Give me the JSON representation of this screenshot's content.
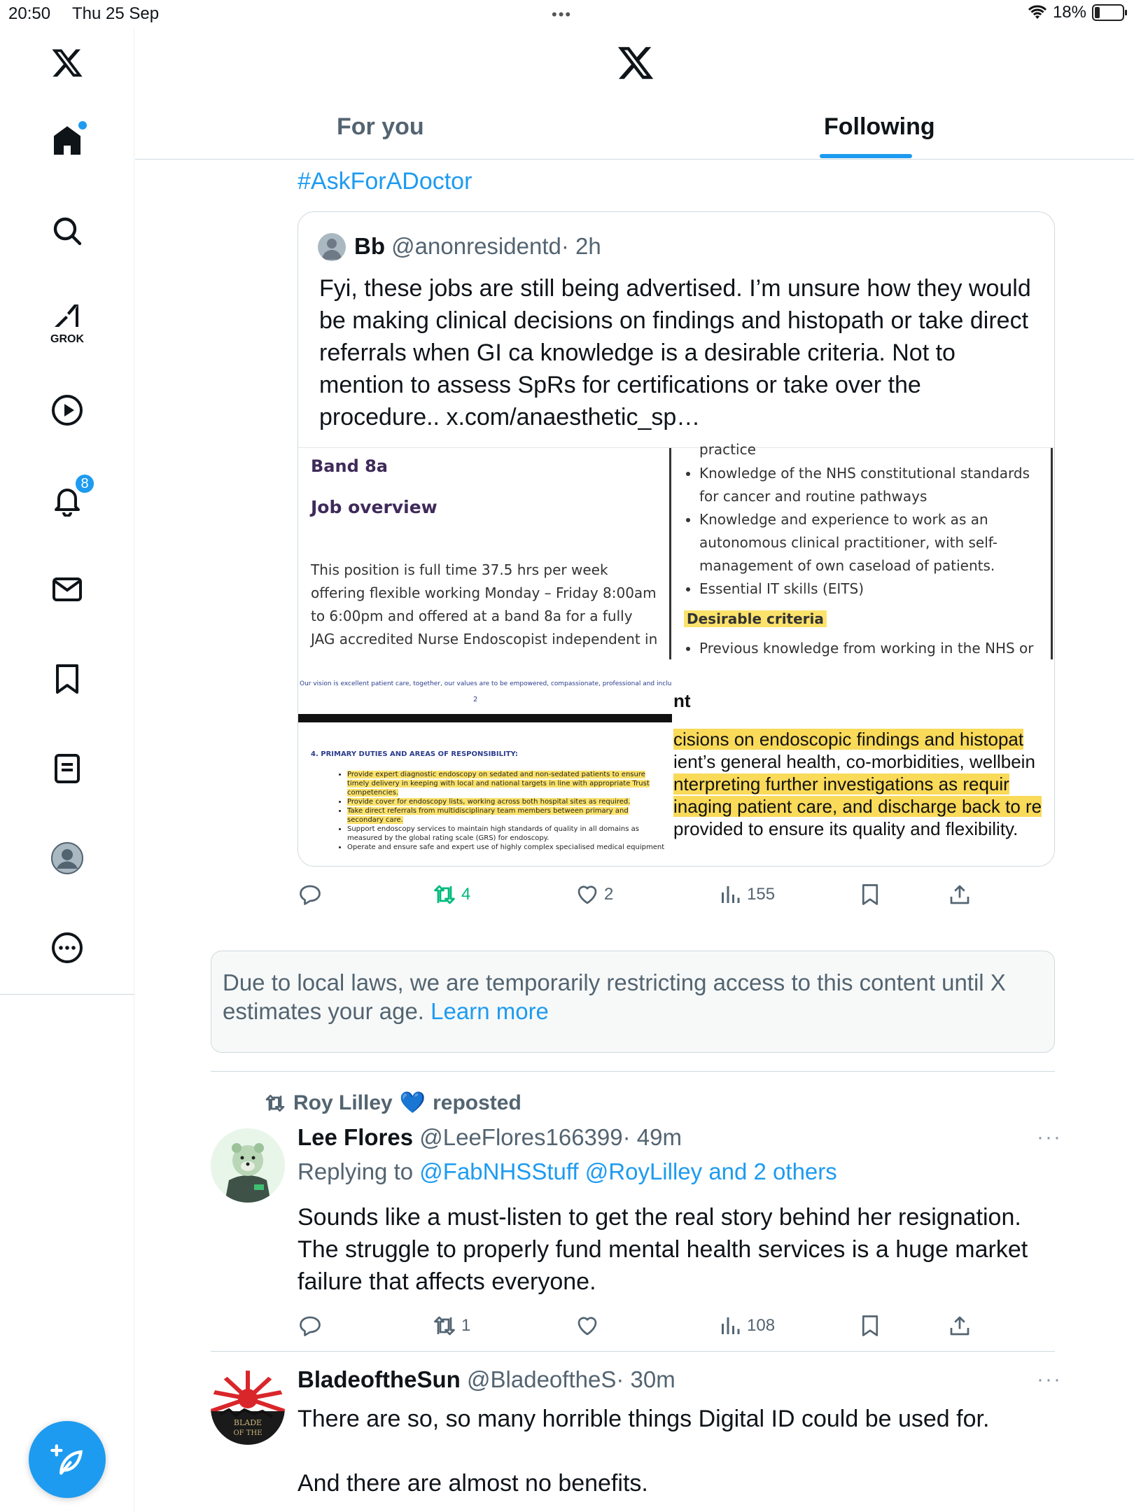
{
  "status_bar": {
    "time": "20:50",
    "date": "Thu 25 Sep",
    "battery": "18%",
    "battery_level_percent": 18
  },
  "sidebar": {
    "items": [
      {
        "icon": "x-logo-icon"
      },
      {
        "icon": "home-icon",
        "has_dot": true
      },
      {
        "icon": "search-icon"
      },
      {
        "icon": "grok-icon",
        "label": "GROK"
      },
      {
        "icon": "play-icon"
      },
      {
        "icon": "bell-icon",
        "badge": "8"
      },
      {
        "icon": "mail-icon"
      },
      {
        "icon": "bookmark-icon"
      },
      {
        "icon": "list-icon"
      },
      {
        "icon": "profile-avatar-icon"
      },
      {
        "icon": "more-circle-icon"
      }
    ],
    "compose_icon": "compose-post-icon",
    "accent": "#1d9bf0"
  },
  "header": {
    "logo": "x-logo-icon",
    "tabs": [
      {
        "label": "For you",
        "active": false
      },
      {
        "label": "Following",
        "active": true
      }
    ]
  },
  "feed": {
    "post1": {
      "hashtag": "#AskForADoctor",
      "quote": {
        "name": "Bb",
        "handle": "@anonresidentd",
        "time": "· 2h",
        "text": "Fyi, these jobs are still being advertised. I’m unsure how they would be making clinical decisions on findings and histopath or take direct referrals when GI ca knowledge is a desirable criteria.  Not to mention to assess SpRs for certifications or take over the procedure.. x.com/anaesthetic_sp…",
        "images": {
          "doc1": {
            "band": "Band 8a",
            "heading": "Job overview",
            "body": "This position is full time 37.5 hrs per week offering flexible working Monday – Friday 8:00am to 6:00pm and offered at a band 8a for a fully JAG accredited Nurse Endoscopist independent in"
          },
          "doc2": {
            "top": "practice",
            "bullets": [
              "Knowledge of the NHS constitutional standards for cancer and routine pathways",
              "Knowledge and experience to work as an autonomous clinical practitioner, with self-management of own caseload of patients.",
              "Essential IT skills (EITS)"
            ],
            "desirable": "Desirable criteria",
            "desirable_item": "Previous knowledge from working in the NHS or"
          },
          "doc3": {
            "vision": "Our vision is excellent patient care, together, our values are to be empowered, compassionate, professional and inclusive.",
            "page": "2",
            "heading": "4.   PRIMARY DUTIES AND AREAS OF RESPONSIBILITY:",
            "bullets": [
              "Provide expert diagnostic endoscopy on sedated and non-sedated patients to ensure timely delivery in keeping with local and national targets in line with appropriate Trust competencies.",
              "Provide cover for endoscopy lists, working across both hospital sites as required.",
              "Take direct referrals from multidisciplinary team members between primary and secondary care.",
              "Support endoscopy services to maintain high standards of quality in all domains as measured by the global rating scale (GRS) for endoscopy.",
              "Operate and ensure safe and expert use of highly complex specialised medical equipment"
            ]
          },
          "doc4": {
            "heading": "nt",
            "lines": [
              "cisions on endoscopic findings and histopat",
              "ient’s general health, co-morbidities, wellbein",
              "nterpreting further investigations as requir",
              "inaging patient care, and discharge back to re",
              "provided to ensure its quality and flexibility."
            ]
          }
        }
      },
      "actions": {
        "replies": "",
        "reposts": "4",
        "likes": "2",
        "views": "155"
      }
    },
    "notice": {
      "text": "Due to local laws, we are temporarily restricting access to this content until X estimates your age.",
      "link": "Learn more"
    },
    "post2": {
      "reposted_by": "Roy Lilley",
      "heart_emoji": "💙",
      "reposted_label": "reposted",
      "name": "Lee Flores",
      "handle": "@LeeFlores166399",
      "time": "· 49m",
      "replying_label": "Replying to",
      "replying_mentions": "@FabNHSStuff @RoyLilley and 2 others",
      "text": "Sounds like a must-listen to get the real story behind her resignation. The struggle to properly fund mental health services is a huge market failure that affects everyone.",
      "more": "···",
      "actions": {
        "replies": "",
        "reposts": "1",
        "likes": "",
        "views": "108"
      }
    },
    "post3": {
      "name": "BladeoftheSun",
      "handle": "@BladeoftheS",
      "time": "· 30m",
      "avatar_text": "BLADE OF THE",
      "text_line1": "There are so, so many horrible things Digital ID could be used for.",
      "text_line2": "And there are almost no benefits.",
      "more": "···"
    }
  }
}
